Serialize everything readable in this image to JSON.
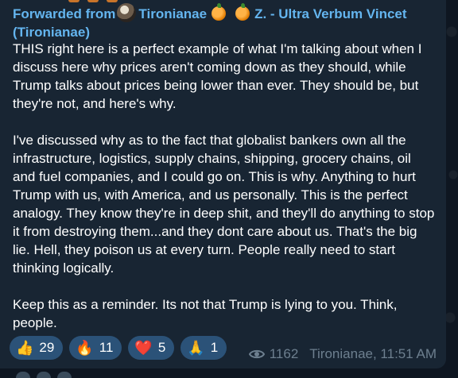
{
  "forward": {
    "prefix": "Forwarded from",
    "channel": "Tironianae",
    "author": "Z. - Ultra Verbum Vincet (Tironianae)"
  },
  "message": {
    "paragraphs": [
      "THIS right here is a perfect example of what I'm talking about when I discuss here why prices aren't coming down as they should, while Trump talks about prices being lower than ever. They should be, but they're not, and here's why.",
      "I've discussed why as to the fact that globalist bankers own all the infrastructure, logistics, supply chains, shipping, grocery chains, oil and fuel companies, and I could go on. This is why. Anything to hurt Trump with us, with America, and us personally. This is the perfect analogy. They know they're in deep shit, and they'll do anything to stop it from destroying them...and they dont care about us. That's the big lie. Hell, they poison us at every turn. People really need to start thinking logically.",
      "Keep this as a reminder. Its not that Trump is lying to you. Think, people."
    ]
  },
  "reactions": [
    {
      "emoji": "👍",
      "count": "29"
    },
    {
      "emoji": "🔥",
      "count": "11"
    },
    {
      "emoji": "❤️",
      "count": "5"
    },
    {
      "emoji": "🙏",
      "count": "1"
    }
  ],
  "meta": {
    "views": "1162",
    "signature": "Tironianae, 11:51 AM"
  },
  "colors": {
    "background": "#0e1621",
    "bubble": "#182533",
    "link": "#64b5ef",
    "reaction_pill": "#2b5278",
    "meta_text": "#6d7f8f"
  }
}
